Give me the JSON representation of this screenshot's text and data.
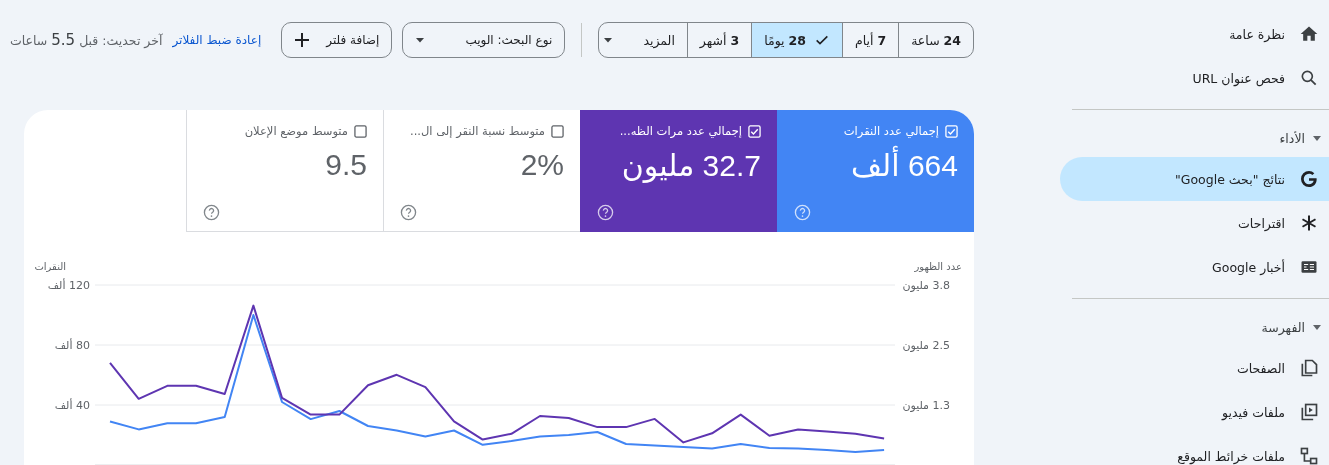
{
  "sidebar": {
    "groups": [
      {
        "items": [
          {
            "label": "نظرة عامة",
            "kind": "home",
            "selected": false
          },
          {
            "label": "فحص عنوان URL",
            "kind": "search",
            "selected": false
          }
        ]
      },
      {
        "label": "الأداء",
        "expanded": true,
        "items": [
          {
            "label": "نتائج \"بحث Google\"",
            "kind": "google",
            "selected": true
          },
          {
            "label": "اقتراحات",
            "kind": "asterisk",
            "selected": false
          },
          {
            "label": "أخبار Google",
            "kind": "news",
            "selected": false
          }
        ]
      },
      {
        "label": "الفهرسة",
        "expanded": true,
        "items": [
          {
            "label": "الصفحات",
            "kind": "pages",
            "selected": false
          },
          {
            "label": "ملفات فيديو",
            "kind": "video",
            "selected": false
          },
          {
            "label": "ملفات خرائط الموقع",
            "kind": "sitemap",
            "selected": false
          }
        ]
      }
    ]
  },
  "toolbar": {
    "date_range": [
      {
        "label": "**24** ساعة",
        "selected": false
      },
      {
        "label": "**7** أيام",
        "selected": false
      },
      {
        "label": "**28** يومًا",
        "selected": true
      },
      {
        "label": "**3** أشهر",
        "selected": false
      }
    ],
    "more": "المزيد",
    "search_type": "نوع البحث: الويب",
    "add_filter": "إضافة فلتر",
    "reset_filters": "إعادة ضبط الفلاتر",
    "last_update": "آخر تحديث: قبل **5.5** ساعات"
  },
  "metrics": [
    {
      "label": "إجمالي عدد النقرات",
      "value": "664 ألف",
      "checked": true,
      "color": "#4285f4"
    },
    {
      "label": "إجمالي عدد مرات الظه...",
      "value": "32.7 مليون",
      "checked": true,
      "color": "#5e35b1"
    },
    {
      "label": "متوسط نسبة النقر إلى ال...",
      "value": "2%",
      "checked": false
    },
    {
      "label": "متوسط موضع الإعلان",
      "value": "9.5",
      "checked": false
    }
  ],
  "chart": {
    "chart_data": {
      "type": "line",
      "ylabel": "النقرات",
      "y2label": "عدد الظهور",
      "ylim": [
        0,
        120
      ],
      "yticks": [
        {
          "value": 40,
          "label": "40 ألف"
        },
        {
          "value": 80,
          "label": "80 ألف"
        },
        {
          "value": 120,
          "label": "120 ألف"
        }
      ],
      "y2lim": [
        0,
        3.75
      ],
      "y2ticks": [
        {
          "value": 1.25,
          "label": "1.3 مليون"
        },
        {
          "value": 2.5,
          "label": "2.5 مليون"
        },
        {
          "value": 3.75,
          "label": "3.8 مليون"
        }
      ],
      "series": [
        {
          "color": "#4285f4",
          "values": [
            29,
            23.7,
            27.8,
            27.8,
            32,
            100,
            42,
            30.6,
            36,
            26,
            23,
            19,
            23,
            13.5,
            16,
            19,
            20,
            22,
            14,
            13,
            12,
            11,
            14,
            11.4,
            11,
            10,
            8.6,
            10
          ]
        },
        {
          "color": "#5e35b1",
          "axis": "y2",
          "values": [
            2.13,
            1.38,
            1.65,
            1.65,
            1.48,
            3.32,
            1.4,
            1.05,
            1.05,
            1.66,
            1.88,
            1.62,
            0.91,
            0.53,
            0.65,
            1.02,
            0.98,
            0.79,
            0.79,
            0.96,
            0.47,
            0.66,
            1.05,
            0.61,
            0.74,
            0.7,
            0.65,
            0.55
          ]
        }
      ]
    }
  }
}
